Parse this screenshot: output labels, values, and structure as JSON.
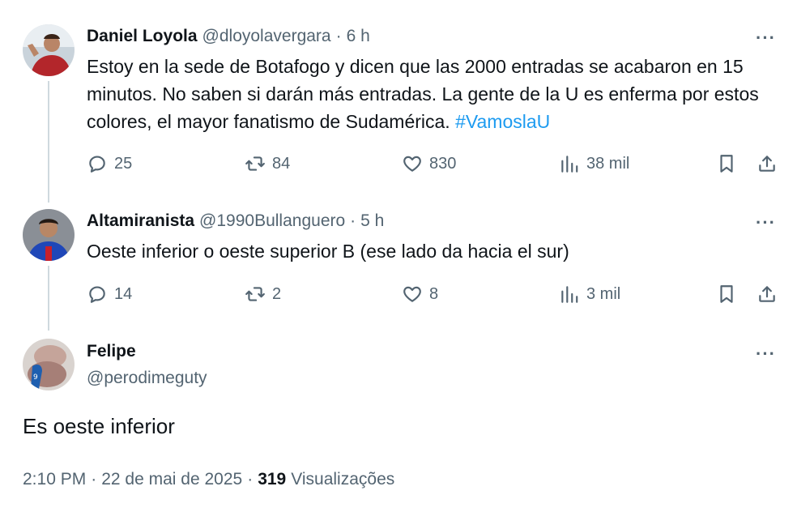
{
  "tweets": [
    {
      "name": "Daniel Loyola",
      "handle": "@dloyolavergara",
      "sep": "·",
      "time": "6 h",
      "text": "Estoy en la sede de Botafogo y dicen que las 2000 entradas se acabaron en 15 minutos. No saben si darán más entradas. La gente de la U es enferma por estos colores,  el mayor fanatismo de Sudamérica.",
      "hashtag": "#VamoslaU",
      "replies": "25",
      "retweets": "84",
      "likes": "830",
      "views": "38 mil"
    },
    {
      "name": "Altamiranista",
      "handle": "@1990Bullanguero",
      "sep": "·",
      "time": "5 h",
      "text": "Oeste inferior o oeste superior B (ese lado da hacia el sur)",
      "replies": "14",
      "retweets": "2",
      "likes": "8",
      "views": "3 mil"
    }
  ],
  "main": {
    "name": "Felipe",
    "handle": "@perodimeguty",
    "text": "Es oeste inferior",
    "time": "2:10 PM",
    "sep1": "·",
    "date": "22 de mai de 2025",
    "sep2": "·",
    "views_count": "319",
    "views_label": "Visualizações"
  },
  "more_label": "···",
  "icons": {
    "reply": "reply-icon",
    "retweet": "retweet-icon",
    "like": "heart-icon",
    "views": "views-chart-icon",
    "bookmark": "bookmark-icon",
    "share": "share-icon",
    "more": "more-icon"
  },
  "colors": {
    "link": "#1d9bf0",
    "muted": "#536471",
    "text": "#0f1419",
    "thread_line": "#cfd9de"
  }
}
